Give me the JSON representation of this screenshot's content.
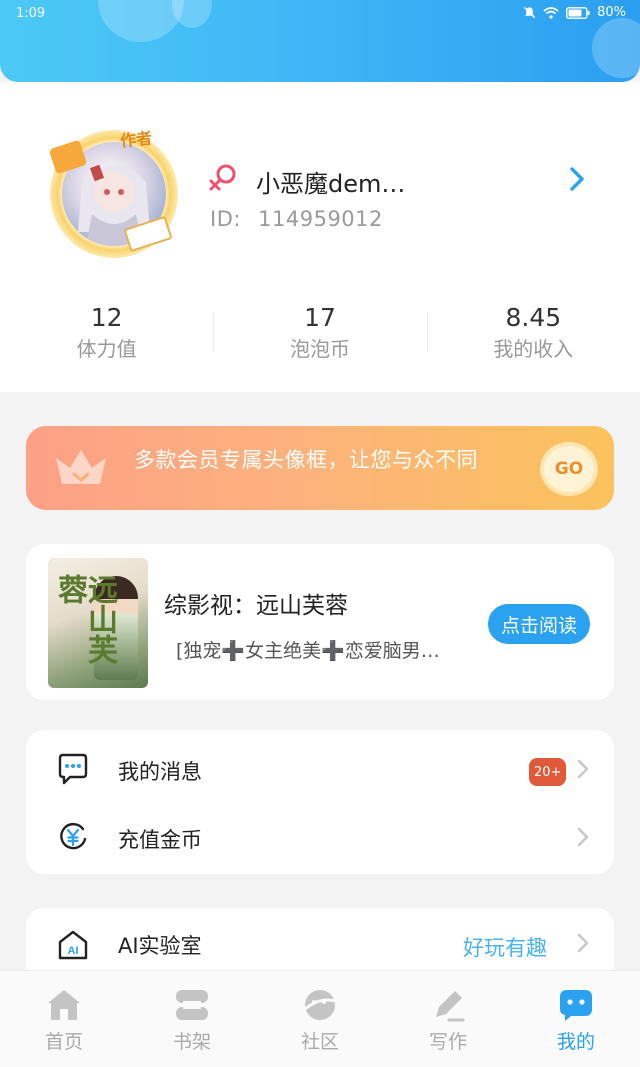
{
  "status_bar": {
    "time": "1:09",
    "battery": "80%"
  },
  "profile": {
    "avatar_badge": "作者",
    "username": "小恶魔dem…",
    "id_label": "ID:",
    "id_value": "114959012"
  },
  "stats": [
    {
      "value": "12",
      "label": "体力值"
    },
    {
      "value": "17",
      "label": "泡泡币"
    },
    {
      "value": "8.45",
      "label": "我的收入"
    }
  ],
  "vip_banner": {
    "text": "多款会员专属头像框，让您与众不同",
    "button": "GO"
  },
  "book": {
    "title": "综影视：远山芙蓉",
    "tags": "[独宠➕女主绝美➕恋爱脑男…",
    "cover_text": "远山芙蓉",
    "read_button": "点击阅读"
  },
  "menu": [
    {
      "label": "我的消息",
      "badge": "20+",
      "icon": "message-icon"
    },
    {
      "label": "充值金币",
      "icon": "coin-icon"
    }
  ],
  "ai_lab": {
    "label": "AI实验室",
    "hint": "好玩有趣",
    "icon": "ai-house-icon"
  },
  "bottom_nav": [
    {
      "label": "首页",
      "icon": "home-icon"
    },
    {
      "label": "书架",
      "icon": "bookshelf-icon"
    },
    {
      "label": "社区",
      "icon": "community-icon"
    },
    {
      "label": "写作",
      "icon": "write-icon"
    },
    {
      "label": "我的",
      "icon": "profile-chat-icon",
      "active": true
    }
  ],
  "colors": {
    "accent": "#2aa2ef",
    "badge": "#e05a3a",
    "header": "#40b8f6"
  }
}
